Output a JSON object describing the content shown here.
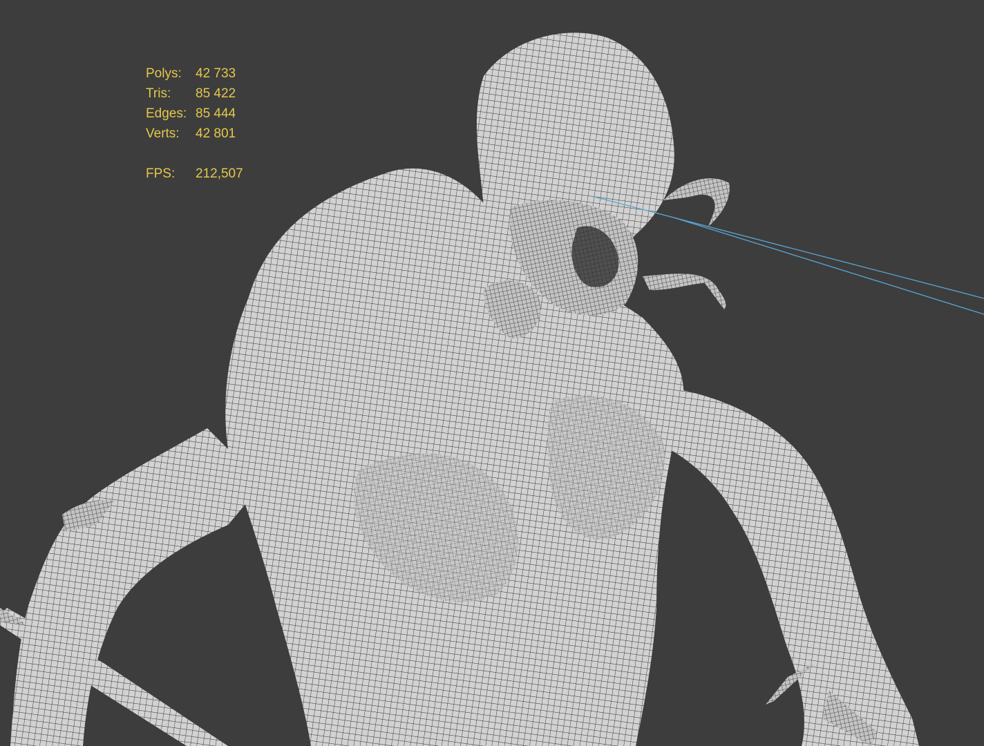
{
  "viewport": {
    "background": "#3d3d3d",
    "model": "creature-wireframe-mesh",
    "mesh_fill": "#cfcfcf",
    "wire_color": "#2a2a2a",
    "guide_line_color": "#5aa7d6"
  },
  "stats": {
    "color": "#e4c84a",
    "polys_label": "Polys:",
    "polys_value": "42 733",
    "tris_label": "Tris:",
    "tris_value": "85 422",
    "edges_label": "Edges:",
    "edges_value": "85 444",
    "verts_label": "Verts:",
    "verts_value": "42 801",
    "fps_label": "FPS:",
    "fps_value": "212,507"
  }
}
